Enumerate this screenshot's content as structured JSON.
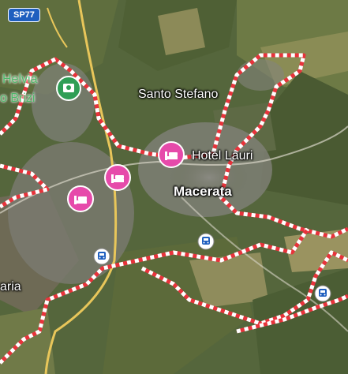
{
  "map": {
    "road_shield": "SP77",
    "labels": {
      "helvia": "Helvia",
      "brizi": "o Brizi",
      "santo_stefano": "Santo Stefano",
      "hotel_lauri": "Hotel Lauri",
      "macerata": "Macerata",
      "aria": "aria"
    },
    "icons": {
      "hotel": "hotel-bed-icon",
      "train": "train-icon",
      "poi": "museum-icon"
    },
    "colors": {
      "boundary_red": "#e8333b",
      "boundary_white": "#ffffff",
      "hotel_pin": "#e64aaa",
      "poi_pin": "#2f9e55",
      "road_yellow": "#e8c65a",
      "shield_blue": "#1f5fbf"
    }
  }
}
